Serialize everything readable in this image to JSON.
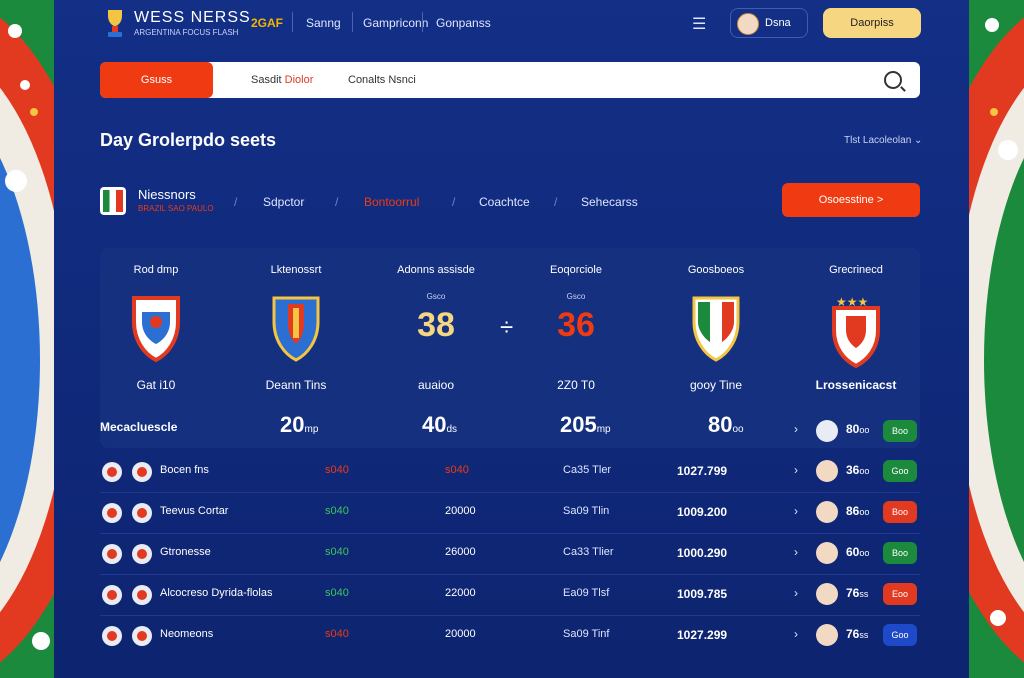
{
  "header": {
    "brand": "WESS NERSS",
    "brand_sub": "ARGENTINA FOCUS FLASH",
    "year": "2GAF",
    "nav": [
      "Sanng",
      "Gampriconn",
      "Gonpanss"
    ],
    "user_name": "Dsna",
    "cta_label": "Daorpiss"
  },
  "search": {
    "pill_label": "Gsuss",
    "tab1_prefix": "Sasdit",
    "tab1_highlight": "Diolor",
    "tab2": "Conalts Nsnci"
  },
  "section": {
    "title": "Day Grolerpdo seets",
    "filter": "Tlst Lacoleolan"
  },
  "subnav": {
    "brand": "Niessnors",
    "brand_sub": "BRAZIL SAO PAULO",
    "links": [
      "Sdpctor",
      "Bontoorrul",
      "Coachtce",
      "Sehecarss"
    ],
    "active_index": 1,
    "primary_btn": "Osoesstine >"
  },
  "match": {
    "columns": [
      {
        "head": "Rod dmp",
        "label": "Gat i10"
      },
      {
        "head": "Lktenossrt",
        "label": "Deann Tins"
      },
      {
        "head": "Adonns assisde",
        "sub": "Gsco",
        "score": "38",
        "label": "auaioo"
      },
      {
        "head": "Eoqorciole",
        "sub": "Gsco",
        "score": "36",
        "label": "2Z0 T0"
      },
      {
        "head": "Goosboeos",
        "label": "gooy Tine"
      },
      {
        "head": "Grecrinecd",
        "label": "Lrossenicacst"
      }
    ],
    "vs": "÷",
    "stats_label": "Mecacluescle",
    "stats": [
      {
        "val": "20",
        "unit": "mp"
      },
      {
        "val": "40",
        "unit": "ds"
      },
      {
        "val": "205",
        "unit": "mp"
      },
      {
        "val": "80",
        "unit": "oo"
      }
    ],
    "stats_extra": {
      "pts": "80",
      "unit": "oo",
      "badge": "Boo"
    }
  },
  "rows": [
    {
      "name": "Bocen fns",
      "c1": "s040",
      "c2": "s040",
      "c3": "Ca35 Tler",
      "c4": "1027.799",
      "pts": "36",
      "unit": "oo",
      "badge": "Goo",
      "badge_color": "green",
      "c1_color": "orange",
      "c2_color": "orange"
    },
    {
      "name": "Teevus Cortar",
      "c1": "s040",
      "c2": "20000",
      "c3": "Sa09 Tlin",
      "c4": "1009.200",
      "pts": "86",
      "unit": "oo",
      "badge": "Boo",
      "badge_color": "red",
      "c1_color": "green",
      "c2_color": "white"
    },
    {
      "name": "Gtronesse",
      "c1": "s040",
      "c2": "26000",
      "c3": "Ca33 Tlier",
      "c4": "1000.290",
      "pts": "60",
      "unit": "oo",
      "badge": "Boo",
      "badge_color": "green",
      "c1_color": "green",
      "c2_color": "white"
    },
    {
      "name": "Alcocreso Dyrida-flolas",
      "c1": "s040",
      "c2": "22000",
      "c3": "Ea09 Tlsf",
      "c4": "1009.785",
      "pts": "76",
      "unit": "ss",
      "badge": "Eoo",
      "badge_color": "red",
      "c1_color": "green",
      "c2_color": "white"
    },
    {
      "name": "Neomeons",
      "c1": "s040",
      "c2": "20000",
      "c3": "Sa09 Tinf",
      "c4": "1027.299",
      "pts": "76",
      "unit": "ss",
      "badge": "Goo",
      "badge_color": "blue",
      "c1_color": "orange",
      "c2_color": "white"
    }
  ]
}
